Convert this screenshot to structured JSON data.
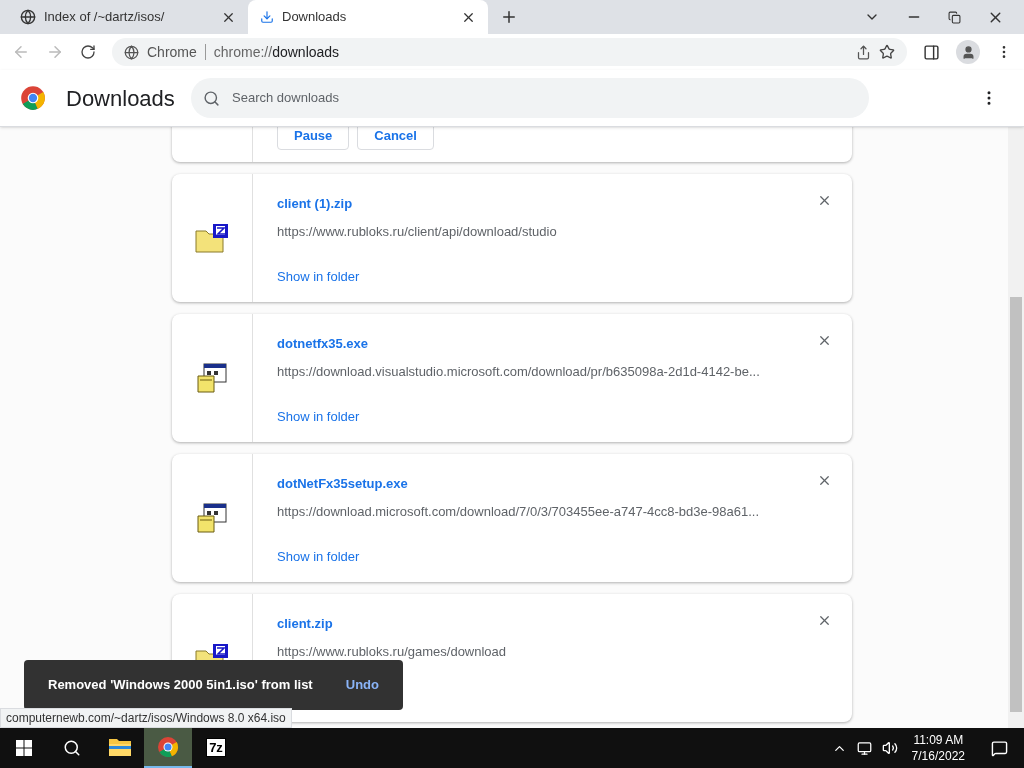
{
  "tabs": [
    {
      "title": "Index of /~dartz/isos/",
      "kind": "page",
      "selected": false
    },
    {
      "title": "Downloads",
      "kind": "download",
      "selected": true
    }
  ],
  "address": {
    "origin": "Chrome",
    "url_prefix": "chrome://",
    "url_path": "downloads"
  },
  "header": {
    "title": "Downloads",
    "search_placeholder": "Search downloads"
  },
  "active_download": {
    "buttons": [
      "Pause",
      "Cancel"
    ]
  },
  "downloads": [
    {
      "name": "client (1).zip",
      "kind": "zip",
      "url": "https://www.rubloks.ru/client/api/download/studio",
      "action": "Show in folder"
    },
    {
      "name": "dotnetfx35.exe",
      "kind": "exe",
      "url": "https://download.visualstudio.microsoft.com/download/pr/b635098a-2d1d-4142-be...",
      "action": "Show in folder"
    },
    {
      "name": "dotNetFx35setup.exe",
      "kind": "exe",
      "url": "https://download.microsoft.com/download/7/0/3/703455ee-a747-4cc8-bd3e-98a61...",
      "action": "Show in folder"
    },
    {
      "name": "client.zip",
      "kind": "zip",
      "url": "https://www.rubloks.ru/games/download"
    }
  ],
  "toast": {
    "message": "Removed 'Windows 2000 5in1.iso' from list",
    "action": "Undo"
  },
  "status_url": "computernewb.com/~dartz/isos/Windows 8.0 x64.iso",
  "taskbar": {
    "apps": [
      {
        "kind": "explorer",
        "selected": false
      },
      {
        "kind": "chrome",
        "selected": true
      },
      {
        "kind": "sevenzip",
        "label": "7z",
        "selected": false
      }
    ],
    "time": "11:09 AM",
    "date": "7/16/2022"
  }
}
